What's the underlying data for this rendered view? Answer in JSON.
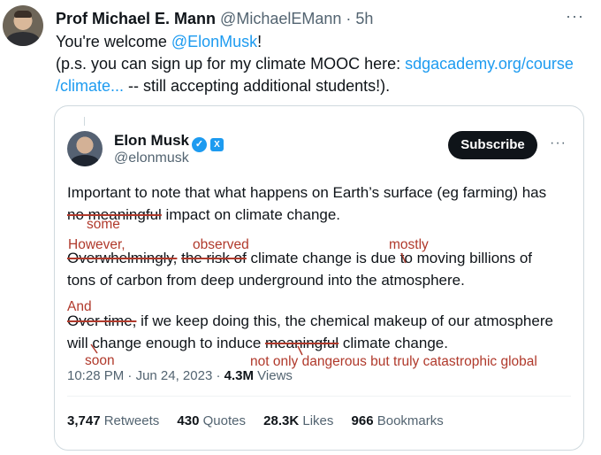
{
  "outer_tweet": {
    "author_name": "Prof Michael E. Mann",
    "handle": "@MichaelEMann",
    "separator": " · ",
    "time": "5h",
    "more": "···",
    "line1_text": "You're welcome ",
    "line1_mention": "@ElonMusk",
    "line1_end": "!",
    "line2_text": "(p.s. you can sign up for my climate MOOC here: ",
    "line2_link": "sdgacademy.org/course",
    "line3_link": "/climate...",
    "line3_text": " -- still accepting additional students!)."
  },
  "quoted_tweet": {
    "author_name": "Elon Musk",
    "verified_check": "✓",
    "affiliate_mark": "X",
    "handle": "@elonmusk",
    "subscribe_label": "Subscribe",
    "more": "···",
    "para1_line1": "Important to note that what happens on Earth’s surface (eg farming) has",
    "para1_line2_struck": "no meaningful",
    "para1_line2_rest": " impact on climate change.",
    "para2_line1_struck_a": "Overwhelmingly,",
    "para2_line1_struck_b": "the risk of",
    "para2_line1_mid": " climate change is due",
    "para2_line1_end": "to moving billions of",
    "para2_line2": "tons of carbon from deep underground into the atmosphere.",
    "para3_line1_struck": "Over time,",
    "para3_line1_rest": " if we keep doing this, the chemical makeup of our atmosphere",
    "para3_line2_start": "will change enough to induce ",
    "para3_line2_struck": "meaningful",
    "para3_line2_end": " climate change.",
    "time": "10:28 PM",
    "date": "Jun 24, 2023",
    "views_count": "4.3M",
    "views_label": " Views",
    "dot": " · ",
    "retweets_count": "3,747",
    "retweets_label": " Retweets",
    "quotes_count": "430",
    "quotes_label": " Quotes",
    "likes_count": "28.3K",
    "likes_label": " Likes",
    "bookmarks_count": "966",
    "bookmarks_label": " Bookmarks"
  },
  "annotations": {
    "some": "some",
    "however": "However,",
    "observed": "observed",
    "mostly": "mostly",
    "and": "And",
    "soon": "soon",
    "replacement": "not only dangerous but truly catastrophic global"
  },
  "colors": {
    "link": "#1d9bf0",
    "annotation": "#b0392b",
    "subscribe_bg": "#0f1419"
  }
}
